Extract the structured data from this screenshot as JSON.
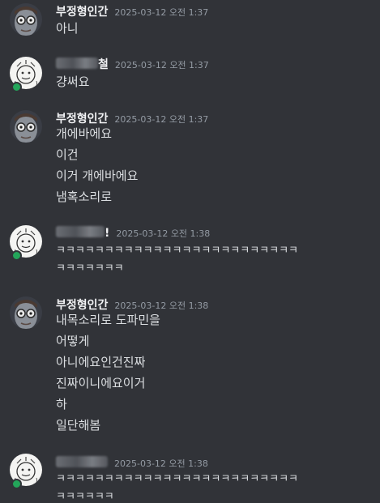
{
  "messages": [
    {
      "author": "부정형인간",
      "author_blurred": false,
      "author_tail": "",
      "timestamp": "2025-03-12 오전 1:37",
      "avatar": "grey-face-glasses-avatar",
      "lines": [
        "아니"
      ]
    },
    {
      "author": "",
      "author_blurred": true,
      "author_tail": "철",
      "timestamp": "2025-03-12 오전 1:37",
      "avatar": "sketch-cartoon-avatar",
      "lines": [
        "걍써요"
      ]
    },
    {
      "author": "부정형인간",
      "author_blurred": false,
      "author_tail": "",
      "timestamp": "2025-03-12 오전 1:37",
      "avatar": "grey-face-glasses-avatar",
      "lines": [
        "개에바에요",
        "이건",
        "이거 개에바에요",
        "냄혹소리로"
      ]
    },
    {
      "author": "",
      "author_blurred": true,
      "author_tail": "!",
      "timestamp": "2025-03-12 오전 1:38",
      "avatar": "sketch-cartoon-avatar",
      "lines": [
        "ㅋㅋㅋㅋㅋㅋㅋㅋㅋㅋㅋㅋㅋㅋㅋㅋㅋㅋㅋㅋㅋㅋㅋㅋㅋ",
        "ㅋㅋㅋㅋㅋㅋㅋ"
      ]
    },
    {
      "author": "부정형인간",
      "author_blurred": false,
      "author_tail": "",
      "timestamp": "2025-03-12 오전 1:38",
      "avatar": "grey-face-glasses-avatar",
      "lines": [
        "내목소리로 도파민을",
        "어떻게",
        "아니에요인건진짜",
        "진짜이니에요이거",
        "하",
        "일단해봄"
      ]
    },
    {
      "author": "",
      "author_blurred": true,
      "author_tail": "",
      "timestamp": "2025-03-12 오전 1:38",
      "avatar": "sketch-cartoon-avatar",
      "lines": [
        "ㅋㅋㅋㅋㅋㅋㅋㅋㅋㅋㅋㅋㅋㅋㅋㅋㅋㅋㅋㅋㅋㅋㅋㅋㅋ",
        "ㅋㅋㅋㅋㅋㅋ"
      ]
    }
  ],
  "colors": {
    "background": "#313338",
    "author": "#f2f3f5",
    "timestamp": "#949ba4",
    "text": "#dbdee1",
    "online": "#23a55a"
  }
}
